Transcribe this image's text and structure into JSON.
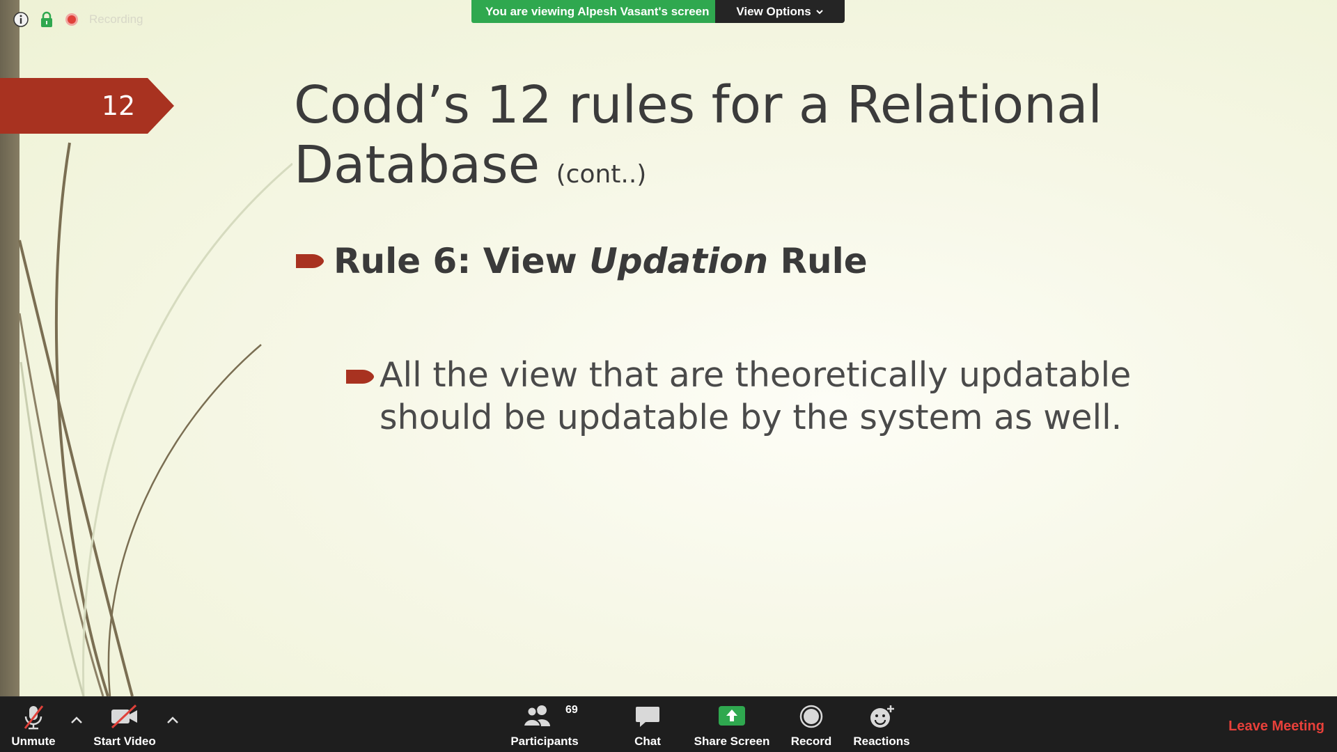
{
  "overlay": {
    "recording_label": "Recording",
    "viewing_banner": "You are viewing Alpesh Vasant's screen",
    "view_options_label": "View Options"
  },
  "slide": {
    "number": "12",
    "title_main": "Codd’s 12 rules for a Relational Database",
    "title_suffix": "(cont..)",
    "rule_prefix": "Rule 6: View ",
    "rule_emphasis": "Updation",
    "rule_suffix": " Rule",
    "body_text": "All the view that are theoretically updatable should be updatable by the system as well."
  },
  "toolbar": {
    "unmute_label": "Unmute",
    "start_video_label": "Start Video",
    "participants_label": "Participants",
    "participants_count": "69",
    "chat_label": "Chat",
    "share_screen_label": "Share Screen",
    "record_label": "Record",
    "reactions_label": "Reactions",
    "leave_label": "Leave Meeting"
  },
  "colors": {
    "share_green": "#2fa84f",
    "accent_red": "#a83220",
    "leave_red": "#e8403a",
    "toolbar_bg": "#1e1e1e"
  },
  "icons": {
    "info": "info-icon",
    "lock": "lock-icon",
    "record_dot": "recording-dot-icon",
    "mic_muted": "microphone-muted-icon",
    "video_off": "video-off-icon",
    "participants": "participants-icon",
    "chat": "chat-icon",
    "share": "share-screen-icon",
    "record": "record-icon",
    "reactions": "reactions-icon"
  }
}
